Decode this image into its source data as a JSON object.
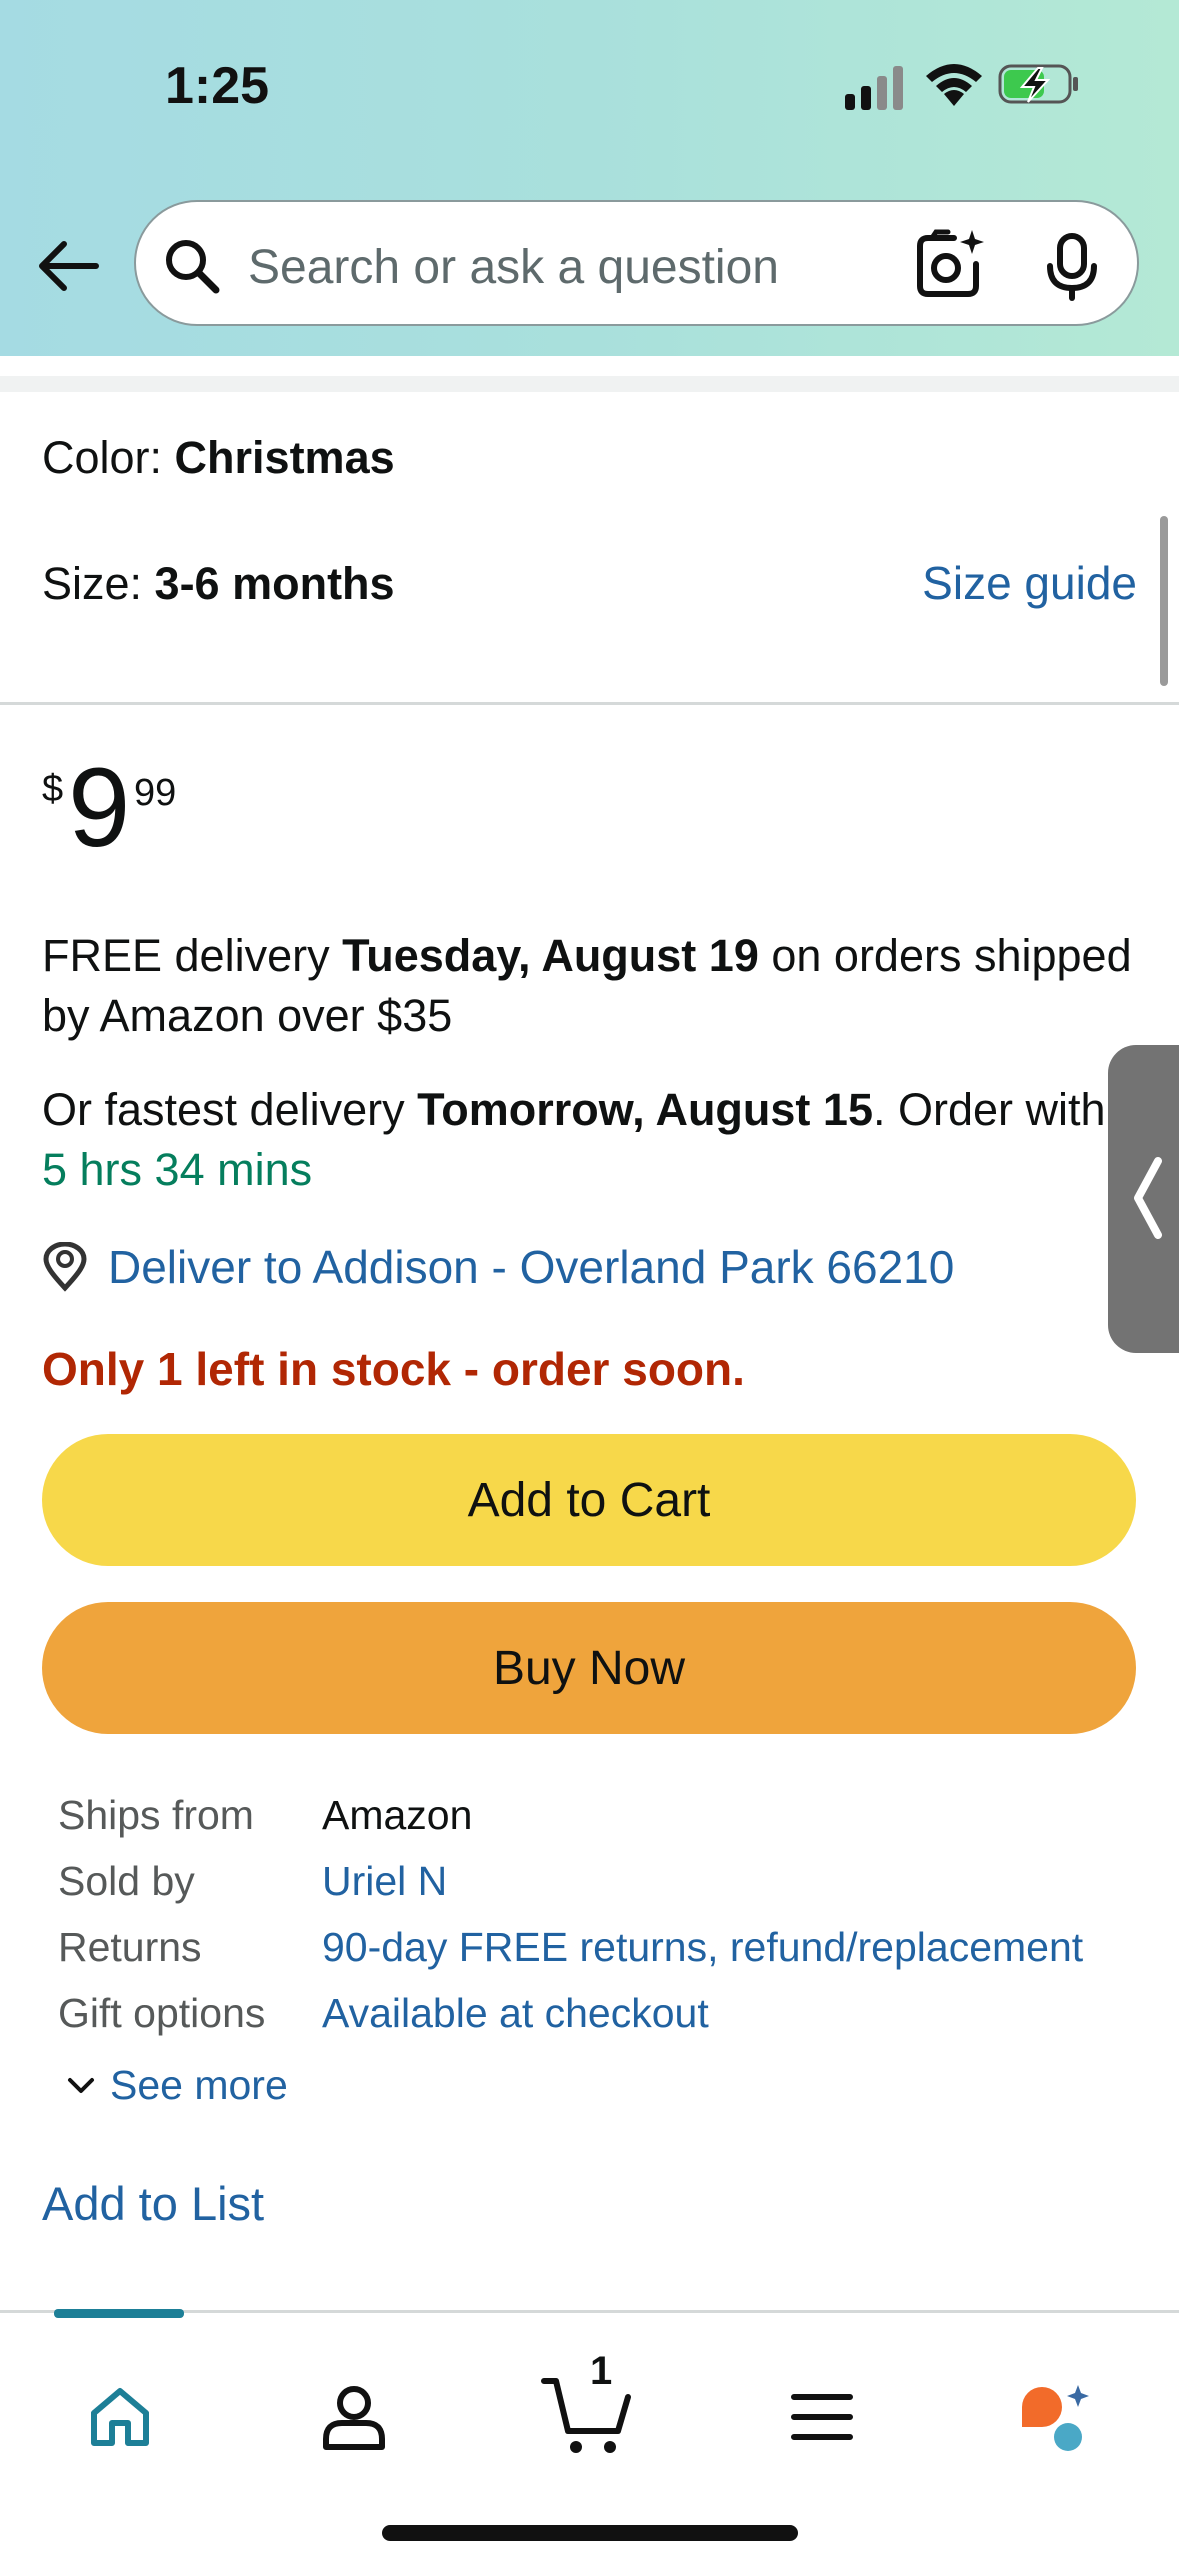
{
  "status_bar": {
    "time": "1:25"
  },
  "search": {
    "placeholder": "Search or ask a question"
  },
  "product": {
    "color_label": "Color: ",
    "color_value": "Christmas",
    "size_label": "Size: ",
    "size_value": "3-6 months",
    "size_guide": "Size guide"
  },
  "price": {
    "symbol": "$",
    "whole": "9",
    "fraction": "99"
  },
  "delivery": {
    "free_prefix": "FREE delivery ",
    "free_date": "Tuesday, August 19",
    "free_suffix": " on orders shipped by Amazon over $35",
    "fast_prefix": "Or fastest delivery ",
    "fast_date": "Tomorrow, August 15",
    "fast_suffix": ". Order within ",
    "countdown": "5 hrs 34 mins",
    "deliver_to": "Deliver to Addison - Overland Park 66210"
  },
  "stock": "Only 1 left in stock - order soon.",
  "buttons": {
    "add_to_cart": "Add to Cart",
    "buy_now": "Buy Now"
  },
  "info": [
    {
      "label": "Ships from",
      "value": "Amazon"
    },
    {
      "label": "Sold by",
      "value": "Uriel N"
    },
    {
      "label": "Returns",
      "value": "90-day FREE returns, refund/replacement"
    },
    {
      "label": "Gift options",
      "value": "Available at checkout"
    }
  ],
  "see_more": "See more",
  "add_to_list": "Add to List",
  "nav": {
    "cart_count": "1"
  },
  "colors": {
    "link": "#2162a1",
    "stock_red": "#b12704",
    "countdown_green": "#057e5d",
    "add_to_cart": "#f7d84a",
    "buy_now": "#efa43c"
  }
}
